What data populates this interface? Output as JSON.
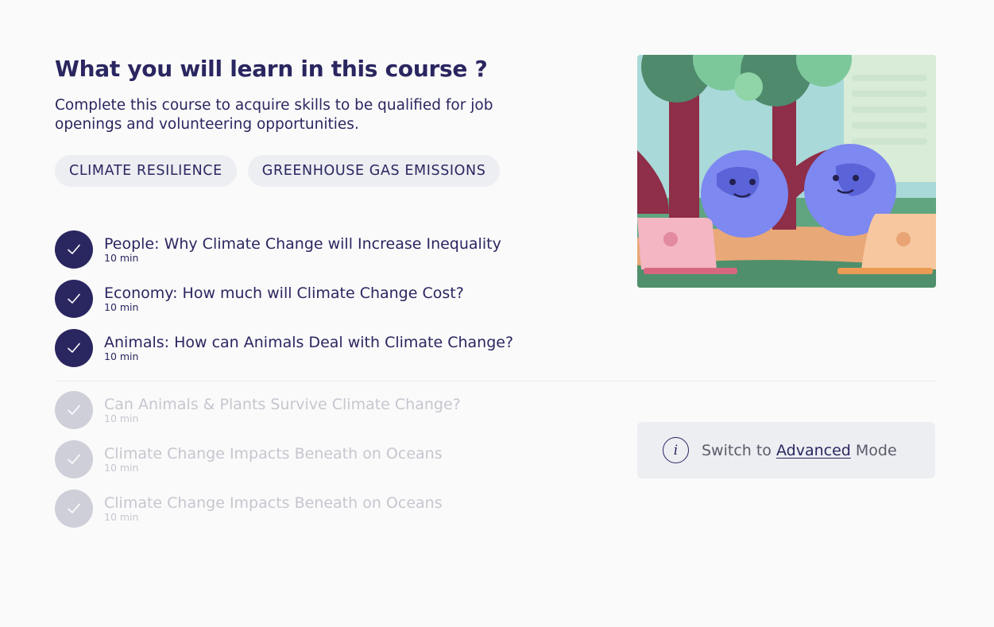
{
  "course": {
    "title": "What you will learn in this course ?",
    "subtitle": "Complete this course to acquire skills to be qualified for job openings and volunteering opportunities.",
    "tags": [
      "CLIMATE RESILIENCE",
      "GREENHOUSE GAS EMISSIONS"
    ]
  },
  "lessons_completed": [
    {
      "title": "People: Why Climate Change will Increase Inequality",
      "duration": "10 min"
    },
    {
      "title": "Economy: How much will Climate Change Cost?",
      "duration": "10 min"
    },
    {
      "title": "Animals: How can Animals Deal with Climate Change?",
      "duration": "10 min"
    }
  ],
  "lessons_locked": [
    {
      "title": "Can Animals & Plants Survive Climate Change?",
      "duration": "10 min"
    },
    {
      "title": "Climate Change Impacts Beneath on Oceans",
      "duration": "10 min"
    },
    {
      "title": "Climate Change Impacts Beneath on Oceans",
      "duration": "10 min"
    }
  ],
  "mode_switch": {
    "prefix": "Switch to",
    "link": "Advanced",
    "suffix": "Mode",
    "icon": "info-icon"
  },
  "colors": {
    "primary": "#2a2660",
    "tag_bg": "#eceef2",
    "locked": "#cfcfd9",
    "background": "#fafafa"
  }
}
